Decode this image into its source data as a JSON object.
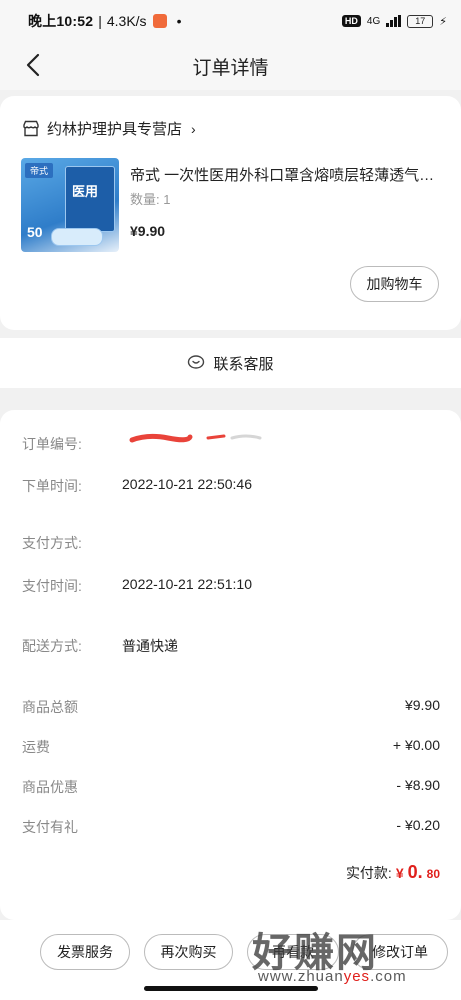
{
  "status_bar": {
    "time": "晚上10:52",
    "speed": "4.3K/s",
    "network_badge": "HD",
    "signal_label": "4G",
    "battery": "17"
  },
  "header": {
    "title": "订单详情"
  },
  "shop": {
    "name": "约林护理护具专营店",
    "arrow": "›"
  },
  "product": {
    "name": "帝式 一次性医用外科口罩含熔喷层轻薄透气口罩",
    "quantity": "数量: 1",
    "price": "¥9.90",
    "thumb_tag": "帝式",
    "thumb_box_text": "医用",
    "thumb_count": "50",
    "add_to_cart": "加购物车"
  },
  "service": {
    "label": "联系客服"
  },
  "order_info": {
    "order_no_label": "订单编号:",
    "order_time_label": "下单时间:",
    "order_time": "2022-10-21 22:50:46",
    "pay_method_label": "支付方式:",
    "pay_time_label": "支付时间:",
    "pay_time": "2022-10-21 22:51:10",
    "delivery_label": "配送方式:",
    "delivery": "普通快递"
  },
  "amounts": {
    "subtotal_label": "商品总额",
    "subtotal": "¥9.90",
    "shipping_label": "运费",
    "shipping": "+ ¥0.00",
    "discount_label": "商品优惠",
    "discount": "- ¥8.90",
    "gift_label": "支付有礼",
    "gift": "- ¥0.20",
    "paid_label": "实付款:",
    "paid_currency": "¥",
    "paid_int": "0.",
    "paid_dec": "80"
  },
  "bottom_actions": {
    "invoice": "发票服务",
    "rebuy": "再次购买",
    "btn3": "再看款",
    "btn4": "修改订单"
  },
  "watermark": {
    "logo": "好赚网",
    "url_prefix": "www.zhuan",
    "url_mid": "yes",
    "url_suffix": ".com"
  },
  "colors": {
    "accent_red": "#e0201c",
    "background": "#f1f1f1",
    "card": "#ffffff"
  }
}
